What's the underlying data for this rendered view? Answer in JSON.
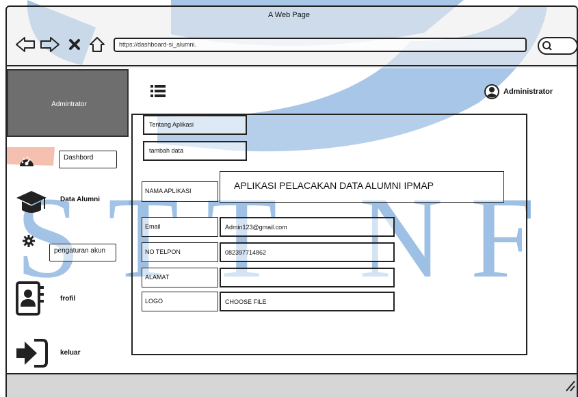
{
  "window": {
    "title": "A Web Page"
  },
  "browser": {
    "url": "https://dashboard-si_alumni."
  },
  "sidebar": {
    "header": "Admintrator",
    "items": [
      {
        "label": "Dashbord",
        "icon": "dashboard-gauge-icon"
      },
      {
        "label": "Data Alumni",
        "icon": "graduation-cap-icon"
      },
      {
        "label": "pengaturan akun",
        "icon": "gear-icon"
      },
      {
        "label": "frofil",
        "icon": "profile-contact-icon"
      },
      {
        "label": "keluar",
        "icon": "logout-arrow-icon"
      }
    ]
  },
  "topbar": {
    "user": "Administrator"
  },
  "panel": {
    "buttons": {
      "about": "Tentang Aplikasi",
      "add": "tambah data"
    },
    "app_name": {
      "label": "NAMA APLIKASI",
      "value": "APLIKASI PELACAKAN DATA ALUMNI IPMAP"
    },
    "fields": [
      {
        "label": "Email",
        "value": "Admin123@gmail.com"
      },
      {
        "label": "NO TELPON",
        "value": "082397714862"
      },
      {
        "label": "ALAMAT",
        "value": ""
      },
      {
        "label": "LOGO",
        "value": "CHOOSE FILE"
      }
    ]
  },
  "watermark": {
    "text": "STT NF",
    "color": "#2f7ac8",
    "accent": "#e8643c"
  }
}
